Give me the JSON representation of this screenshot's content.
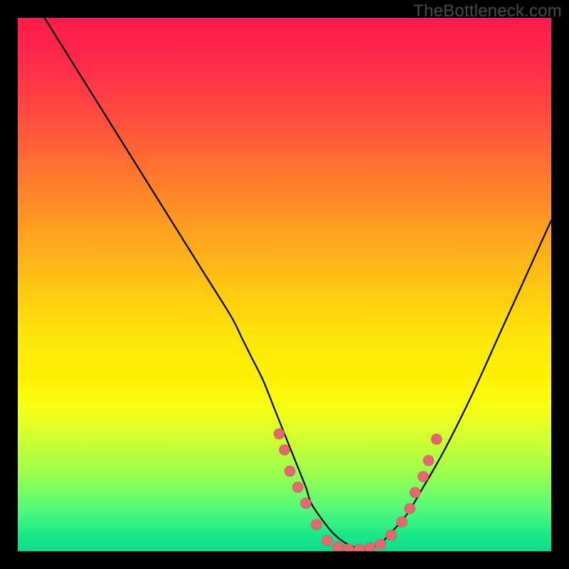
{
  "watermark": "TheBottleneck.com",
  "colors": {
    "curve_stroke": "#000000",
    "marker_fill": "#e06a6f",
    "marker_stroke": "#c85358",
    "gradient_top": "#ff1a4d",
    "gradient_bottom": "#10d98a"
  },
  "chart_data": {
    "type": "line",
    "title": "",
    "xlabel": "",
    "ylabel": "",
    "xlim": [
      0,
      100
    ],
    "ylim": [
      0,
      100
    ],
    "series": [
      {
        "name": "bottleneck-curve",
        "x": [
          5,
          10,
          15,
          20,
          25,
          30,
          35,
          40,
          42,
          44,
          46,
          48,
          50,
          52,
          54,
          55,
          57,
          59,
          61,
          63,
          64.5,
          66,
          68,
          70,
          73,
          76,
          80,
          85,
          90,
          95,
          100
        ],
        "y": [
          100,
          92,
          84,
          76,
          68,
          60,
          52,
          44,
          40,
          36,
          32,
          27,
          22,
          17,
          12,
          9,
          6,
          3.5,
          1.8,
          0.8,
          0.3,
          0.5,
          1.5,
          3.5,
          7,
          12,
          19,
          29,
          40,
          51,
          62
        ]
      }
    ],
    "markers": [
      {
        "x": 49,
        "y": 22
      },
      {
        "x": 50,
        "y": 19
      },
      {
        "x": 51,
        "y": 15
      },
      {
        "x": 52.5,
        "y": 12
      },
      {
        "x": 54,
        "y": 9
      },
      {
        "x": 56,
        "y": 5
      },
      {
        "x": 58,
        "y": 2
      },
      {
        "x": 60,
        "y": 0.8
      },
      {
        "x": 62,
        "y": 0.4
      },
      {
        "x": 64,
        "y": 0.3
      },
      {
        "x": 66,
        "y": 0.6
      },
      {
        "x": 68,
        "y": 1.3
      },
      {
        "x": 70,
        "y": 3.0
      },
      {
        "x": 72,
        "y": 5.5
      },
      {
        "x": 73.5,
        "y": 8
      },
      {
        "x": 74.5,
        "y": 11
      },
      {
        "x": 76,
        "y": 14
      },
      {
        "x": 77,
        "y": 17
      },
      {
        "x": 78.5,
        "y": 21
      }
    ],
    "marker_radius": 7.5
  }
}
